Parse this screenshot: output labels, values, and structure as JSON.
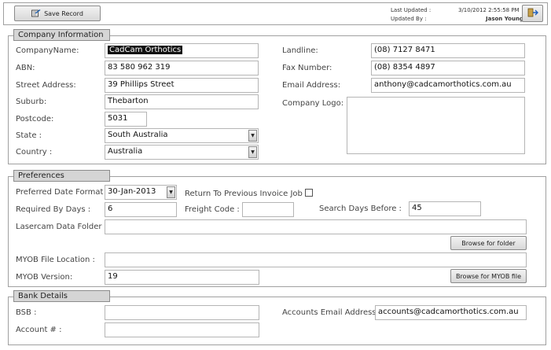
{
  "toolbar": {
    "save_label": "Save Record",
    "last_updated_label": "Last Updated :",
    "last_updated_value": "3/10/2012 2:55:58 PM",
    "updated_by_label": "Updated By :",
    "updated_by_value": "Jason Young"
  },
  "company": {
    "section_title": "Company Information",
    "company_name_label": "CompanyName:",
    "company_name": "CadCam Orthotics",
    "abn_label": "ABN:",
    "abn": "83 580 962 319",
    "street_label": "Street Address:",
    "street": "39 Phillips Street",
    "suburb_label": "Suburb:",
    "suburb": "Thebarton",
    "postcode_label": "Postcode:",
    "postcode": "5031",
    "state_label": "State :",
    "state": "South Australia",
    "country_label": "Country :",
    "country": "Australia",
    "landline_label": "Landline:",
    "landline": "(08) 7127 8471",
    "fax_label": "Fax Number:",
    "fax": "(08) 8354 4897",
    "email_label": "Email Address:",
    "email": "anthony@cadcamorthotics.com.au",
    "logo_label": "Company Logo:"
  },
  "preferences": {
    "section_title": "Preferences",
    "date_format_label": "Preferred Date Format :",
    "date_format": "30-Jan-2013",
    "return_invoice_label": "Return To Previous Invoice Job :",
    "required_days_label": "Required By Days :",
    "required_days": "6",
    "freight_code_label": "Freight Code :",
    "freight_code": "",
    "search_days_label": "Search Days Before :",
    "search_days": "45",
    "lasercam_label": "Lasercam Data Folder :",
    "lasercam_folder": "",
    "browse_folder_label": "Browse for folder",
    "myob_location_label": "MYOB File Location :",
    "myob_location": "",
    "myob_version_label": "MYOB Version:",
    "myob_version": "19",
    "browse_myob_label": "Browse for MYOB file"
  },
  "bank": {
    "section_title": "Bank Details",
    "bsb_label": "BSB :",
    "bsb": "",
    "account_label": "Account # :",
    "account": "",
    "accounts_email_label": "Accounts Email Address :",
    "accounts_email": "accounts@cadcamorthotics.com.au"
  }
}
